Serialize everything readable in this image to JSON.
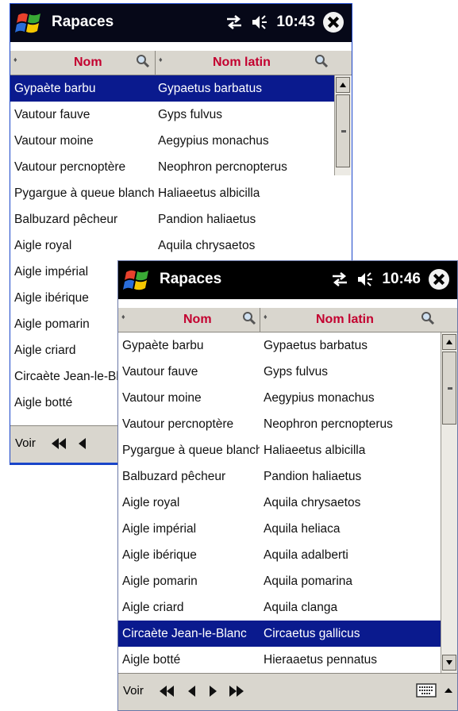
{
  "colors": {
    "selection": "#0a1a8e",
    "header_text": "#c3002f",
    "titlebar": "#000000",
    "chrome": "#d9d6ce"
  },
  "icons": [
    "windows-logo-icon",
    "connectivity-icon",
    "speaker-icon",
    "close-icon",
    "sort-icon",
    "search-icon",
    "first-page-icon",
    "prev-icon",
    "next-icon",
    "last-page-icon",
    "keyboard-icon"
  ],
  "back_window": {
    "title": "Rapaces",
    "time": "10:43",
    "col_nom": "Nom",
    "col_latin": "Nom latin",
    "view_label": "Voir",
    "rows": [
      {
        "nom": "Gypaète barbu",
        "latin": "Gypaetus barbatus",
        "selected": true
      },
      {
        "nom": "Vautour fauve",
        "latin": "Gyps fulvus"
      },
      {
        "nom": "Vautour moine",
        "latin": "Aegypius monachus"
      },
      {
        "nom": "Vautour percnoptère",
        "latin": "Neophron percnopterus"
      },
      {
        "nom": "Pygargue à queue blanche",
        "latin": "Haliaeetus albicilla"
      },
      {
        "nom": "Balbuzard pêcheur",
        "latin": "Pandion haliaetus"
      },
      {
        "nom": "Aigle royal",
        "latin": "Aquila chrysaetos"
      },
      {
        "nom": "Aigle impérial",
        "latin": ""
      },
      {
        "nom": "Aigle ibérique",
        "latin": ""
      },
      {
        "nom": "Aigle pomarin",
        "latin": ""
      },
      {
        "nom": "Aigle criard",
        "latin": ""
      },
      {
        "nom": "Circaète Jean-le-Blanc",
        "latin": ""
      },
      {
        "nom": "Aigle botté",
        "latin": ""
      }
    ]
  },
  "front_window": {
    "title": "Rapaces",
    "time": "10:46",
    "col_nom": "Nom",
    "col_latin": "Nom latin",
    "view_label": "Voir",
    "rows": [
      {
        "nom": "Gypaète barbu",
        "latin": "Gypaetus barbatus"
      },
      {
        "nom": "Vautour fauve",
        "latin": "Gyps fulvus"
      },
      {
        "nom": "Vautour moine",
        "latin": "Aegypius monachus"
      },
      {
        "nom": "Vautour percnoptère",
        "latin": "Neophron percnopterus"
      },
      {
        "nom": "Pygargue à queue blanche",
        "latin": "Haliaeetus albicilla"
      },
      {
        "nom": "Balbuzard pêcheur",
        "latin": "Pandion haliaetus"
      },
      {
        "nom": "Aigle royal",
        "latin": "Aquila chrysaetos"
      },
      {
        "nom": "Aigle impérial",
        "latin": "Aquila heliaca"
      },
      {
        "nom": "Aigle ibérique",
        "latin": "Aquila adalberti"
      },
      {
        "nom": "Aigle pomarin",
        "latin": "Aquila pomarina"
      },
      {
        "nom": "Aigle criard",
        "latin": "Aquila clanga"
      },
      {
        "nom": "Circaète Jean-le-Blanc",
        "latin": "Circaetus gallicus",
        "selected": true
      },
      {
        "nom": "Aigle botté",
        "latin": "Hieraaetus pennatus"
      }
    ]
  }
}
